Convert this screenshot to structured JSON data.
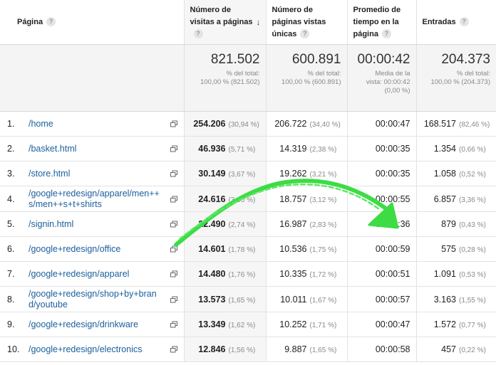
{
  "headers": {
    "page": "Página",
    "visits": "Número de visitas a páginas",
    "unique": "Número de páginas vistas únicas",
    "time": "Promedio de tiempo en la página",
    "entries": "Entradas"
  },
  "help_glyph": "?",
  "sort_glyph": "↓",
  "totals": {
    "visits": {
      "value": "821.502",
      "line1": "% del total:",
      "line2": "100,00 % (821.502)"
    },
    "unique": {
      "value": "600.891",
      "line1": "% del total:",
      "line2": "100,00 % (600.891)"
    },
    "time": {
      "value": "00:00:42",
      "line1": "Media de la",
      "line2": "vista: 00:00:42",
      "line3": "(0,00 %)"
    },
    "entries": {
      "value": "204.373",
      "line1": "% del total:",
      "line2": "100,00 % (204.373)"
    }
  },
  "rows": [
    {
      "rank": "1.",
      "page": "/home",
      "visits": "254.206",
      "visits_pct": "(30,94 %)",
      "unique": "206.722",
      "unique_pct": "(34,40 %)",
      "time": "00:00:47",
      "entries": "168.517",
      "entries_pct": "(82,46 %)"
    },
    {
      "rank": "2.",
      "page": "/basket.html",
      "visits": "46.936",
      "visits_pct": "(5,71 %)",
      "unique": "14.319",
      "unique_pct": "(2,38 %)",
      "time": "00:00:35",
      "entries": "1.354",
      "entries_pct": "(0,66 %)"
    },
    {
      "rank": "3.",
      "page": "/store.html",
      "visits": "30.149",
      "visits_pct": "(3,67 %)",
      "unique": "19.262",
      "unique_pct": "(3,21 %)",
      "time": "00:00:35",
      "entries": "1.058",
      "entries_pct": "(0,52 %)"
    },
    {
      "rank": "4.",
      "page": "/google+redesign/apparel/men++s/men++s+t+shirts",
      "visits": "24.616",
      "visits_pct": "(3,00 %)",
      "unique": "18.757",
      "unique_pct": "(3,12 %)",
      "time": "00:00:55",
      "entries": "6.857",
      "entries_pct": "(3,36 %)"
    },
    {
      "rank": "5.",
      "page": "/signin.html",
      "visits": "22.490",
      "visits_pct": "(2,74 %)",
      "unique": "16.987",
      "unique_pct": "(2,83 %)",
      "time": "00:00:36",
      "entries": "879",
      "entries_pct": "(0,43 %)"
    },
    {
      "rank": "6.",
      "page": "/google+redesign/office",
      "visits": "14.601",
      "visits_pct": "(1,78 %)",
      "unique": "10.536",
      "unique_pct": "(1,75 %)",
      "time": "00:00:59",
      "entries": "575",
      "entries_pct": "(0,28 %)"
    },
    {
      "rank": "7.",
      "page": "/google+redesign/apparel",
      "visits": "14.480",
      "visits_pct": "(1,76 %)",
      "unique": "10.335",
      "unique_pct": "(1,72 %)",
      "time": "00:00:51",
      "entries": "1.091",
      "entries_pct": "(0,53 %)"
    },
    {
      "rank": "8.",
      "page": "/google+redesign/shop+by+brand/youtube",
      "visits": "13.573",
      "visits_pct": "(1,65 %)",
      "unique": "10.011",
      "unique_pct": "(1,67 %)",
      "time": "00:00:57",
      "entries": "3.163",
      "entries_pct": "(1,55 %)"
    },
    {
      "rank": "9.",
      "page": "/google+redesign/drinkware",
      "visits": "13.349",
      "visits_pct": "(1,62 %)",
      "unique": "10.252",
      "unique_pct": "(1,71 %)",
      "time": "00:00:47",
      "entries": "1.572",
      "entries_pct": "(0,77 %)"
    },
    {
      "rank": "10.",
      "page": "/google+redesign/electronics",
      "visits": "12.846",
      "visits_pct": "(1,56 %)",
      "unique": "9.887",
      "unique_pct": "(1,65 %)",
      "time": "00:00:58",
      "entries": "457",
      "entries_pct": "(0,22 %)"
    }
  ],
  "colors": {
    "link": "#1a5f9c",
    "annotation_arrow": "#3ddc45",
    "sorted_column_bg": "#f6f6f6",
    "totals_bg": "#f4f4f4"
  }
}
